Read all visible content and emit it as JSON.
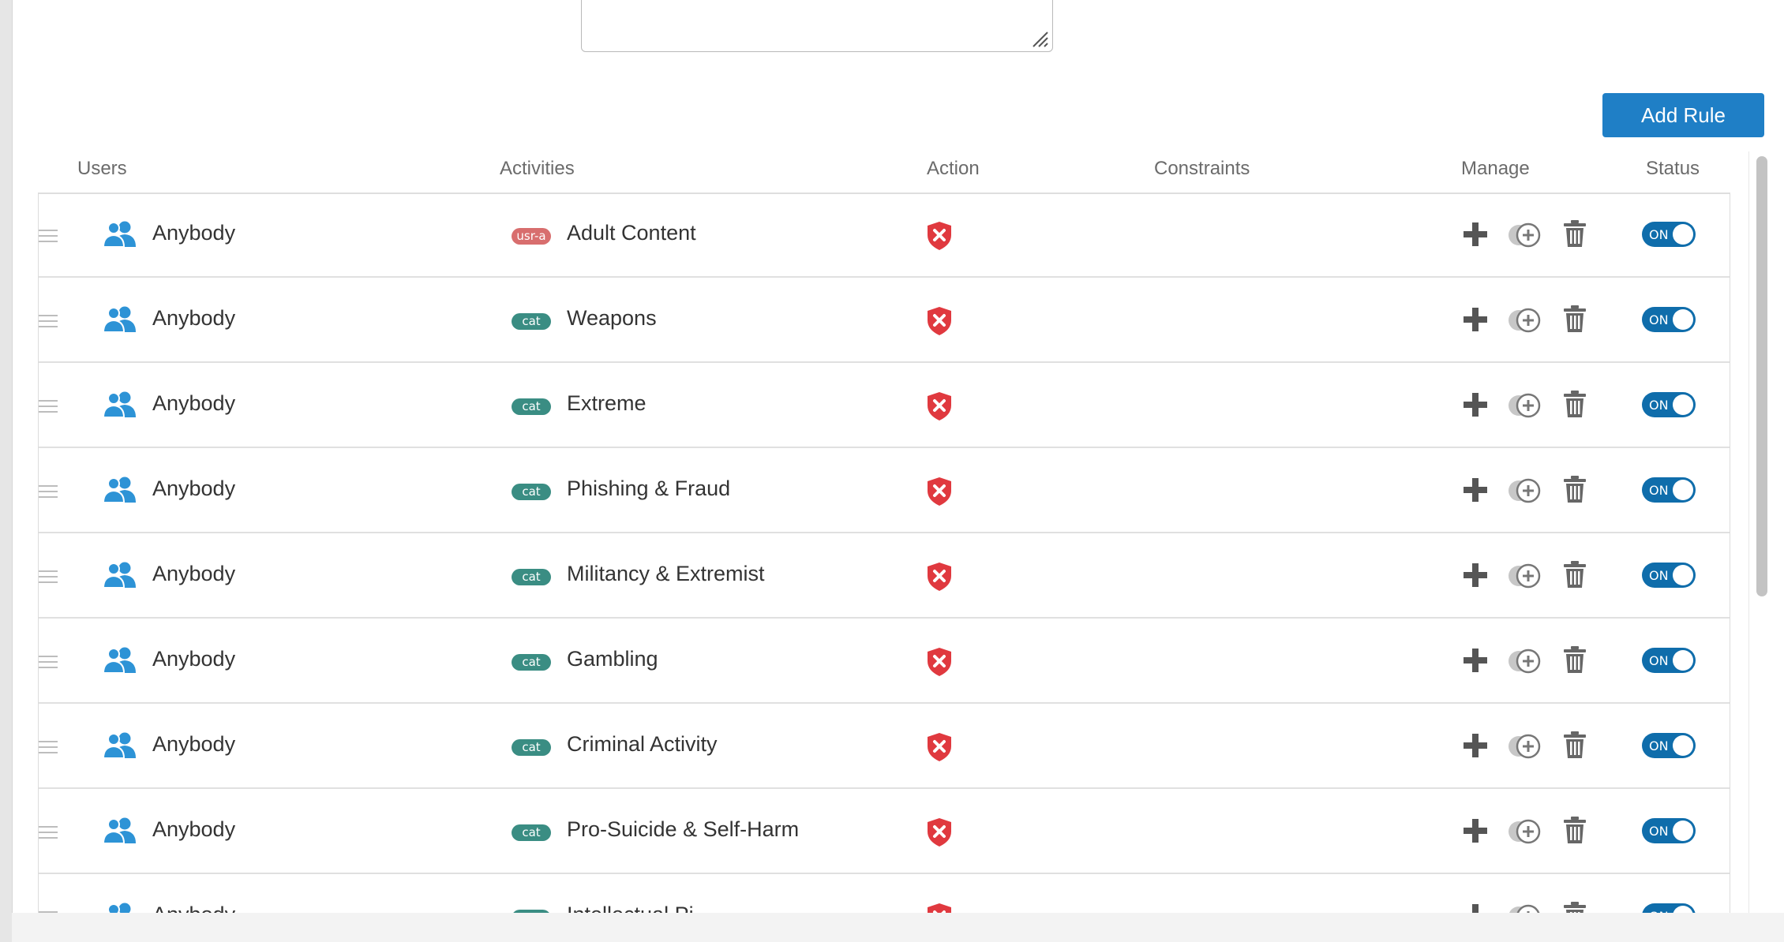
{
  "toolbar": {
    "add_rule_label": "Add Rule"
  },
  "table": {
    "headers": {
      "users": "Users",
      "activities": "Activities",
      "action": "Action",
      "constraints": "Constraints",
      "manage": "Manage",
      "status": "Status"
    },
    "rows": [
      {
        "user": "Anybody",
        "badge": "usr-a",
        "badge_color": "#d86e6e",
        "activity": "Adult Content",
        "status": "ON"
      },
      {
        "user": "Anybody",
        "badge": "cat",
        "badge_color": "#3a8d83",
        "activity": "Weapons",
        "status": "ON"
      },
      {
        "user": "Anybody",
        "badge": "cat",
        "badge_color": "#3a8d83",
        "activity": "Extreme",
        "status": "ON"
      },
      {
        "user": "Anybody",
        "badge": "cat",
        "badge_color": "#3a8d83",
        "activity": "Phishing & Fraud",
        "status": "ON"
      },
      {
        "user": "Anybody",
        "badge": "cat",
        "badge_color": "#3a8d83",
        "activity": "Militancy & Extremist",
        "status": "ON"
      },
      {
        "user": "Anybody",
        "badge": "cat",
        "badge_color": "#3a8d83",
        "activity": "Gambling",
        "status": "ON"
      },
      {
        "user": "Anybody",
        "badge": "cat",
        "badge_color": "#3a8d83",
        "activity": "Criminal Activity",
        "status": "ON"
      },
      {
        "user": "Anybody",
        "badge": "cat",
        "badge_color": "#3a8d83",
        "activity": "Pro-Suicide & Self-Harm",
        "status": "ON"
      },
      {
        "user": "Anybody",
        "badge": "cat",
        "badge_color": "#3a8d83",
        "activity": "Intellectual Pi",
        "status": "ON"
      }
    ]
  },
  "icons": {
    "user": "users-group-icon",
    "action": "block-shield-icon",
    "add": "plus-icon",
    "add_rule_below": "add-circle-icon",
    "delete": "trash-icon",
    "drag": "drag-handle-icon"
  },
  "colors": {
    "primary": "#1f7fc6",
    "toggle_on": "#0f6dab",
    "block_red": "#e0393f",
    "user_blue": "#2d93d6"
  }
}
